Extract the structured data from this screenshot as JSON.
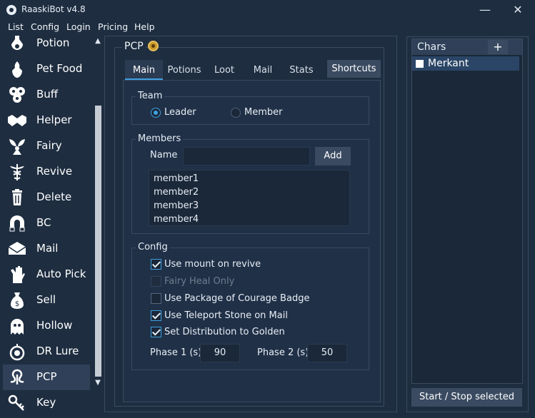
{
  "window": {
    "title": "RaaskiBot v4.8",
    "minimize": "—",
    "close": "✕"
  },
  "menu": [
    "List",
    "Config",
    "Login",
    "Pricing",
    "Help"
  ],
  "sidebar": {
    "items": [
      {
        "label": "Potion",
        "icon": "potion-icon"
      },
      {
        "label": "Pet Food",
        "icon": "pet-food-icon"
      },
      {
        "label": "Buff",
        "icon": "buff-icon"
      },
      {
        "label": "Helper",
        "icon": "handshake-icon"
      },
      {
        "label": "Fairy",
        "icon": "fairy-icon"
      },
      {
        "label": "Revive",
        "icon": "caduceus-icon"
      },
      {
        "label": "Delete",
        "icon": "trash-icon"
      },
      {
        "label": "BC",
        "icon": "magnet-icon"
      },
      {
        "label": "Mail",
        "icon": "mail-icon"
      },
      {
        "label": "Auto Pick",
        "icon": "hand-icon"
      },
      {
        "label": "Sell",
        "icon": "money-bag-icon"
      },
      {
        "label": "Hollow",
        "icon": "ghost-icon"
      },
      {
        "label": "DR Lure",
        "icon": "bomb-icon"
      },
      {
        "label": "PCP",
        "icon": "tentacle-icon"
      },
      {
        "label": "Key",
        "icon": "key-icon"
      }
    ],
    "active": "PCP"
  },
  "panel": {
    "title": "PCP",
    "tabs": [
      "Main",
      "Potions",
      "Loot",
      "Mail",
      "Stats"
    ],
    "shortcuts_button": "Shortcuts",
    "active_tab": "Main",
    "team": {
      "title": "Team",
      "options": [
        "Leader",
        "Member"
      ],
      "selected": "Leader"
    },
    "members": {
      "title": "Members",
      "name_label": "Name",
      "name_value": "",
      "add_button": "Add",
      "list": [
        "member1",
        "member2",
        "member3",
        "member4"
      ]
    },
    "config": {
      "title": "Config",
      "options": [
        {
          "label": "Use mount on revive",
          "checked": true,
          "enabled": true
        },
        {
          "label": "Fairy Heal Only",
          "checked": false,
          "enabled": false
        },
        {
          "label": "Use Package of Courage Badge",
          "checked": false,
          "enabled": true
        },
        {
          "label": "Use Teleport Stone on Mail",
          "checked": true,
          "enabled": true
        },
        {
          "label": "Set Distribution to Golden",
          "checked": true,
          "enabled": true
        }
      ],
      "phase1_label": "Phase 1 (s)",
      "phase1_value": "90",
      "phase2_label": "Phase 2 (s)",
      "phase2_value": "50"
    }
  },
  "chars": {
    "title": "Chars",
    "add_button": "+",
    "list": [
      {
        "name": "Merkant",
        "checked": false
      }
    ],
    "start_stop_button": "Start / Stop selected"
  },
  "colors": {
    "background": "#1e2d40",
    "accent": "#3fa0e0",
    "button": "#3a4b61",
    "input": "#1a2839"
  }
}
